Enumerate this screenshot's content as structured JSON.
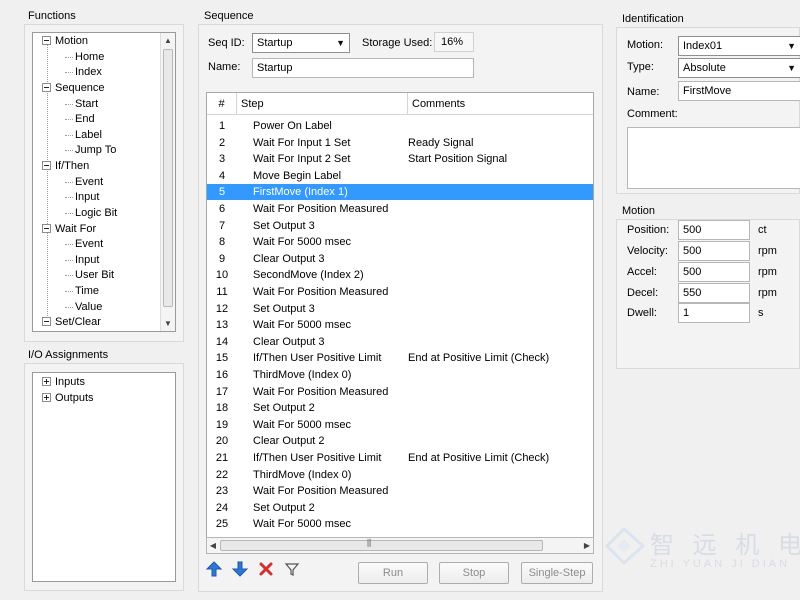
{
  "functions": {
    "title": "Functions",
    "items": [
      {
        "label": "Motion",
        "level": 0,
        "expand": "minus"
      },
      {
        "label": "Home",
        "level": 1
      },
      {
        "label": "Index",
        "level": 1
      },
      {
        "label": "Sequence",
        "level": 0,
        "expand": "minus"
      },
      {
        "label": "Start",
        "level": 1
      },
      {
        "label": "End",
        "level": 1
      },
      {
        "label": "Label",
        "level": 1
      },
      {
        "label": "Jump To",
        "level": 1
      },
      {
        "label": "If/Then",
        "level": 0,
        "expand": "minus"
      },
      {
        "label": "Event",
        "level": 1
      },
      {
        "label": "Input",
        "level": 1
      },
      {
        "label": "Logic Bit",
        "level": 1
      },
      {
        "label": "Wait For",
        "level": 0,
        "expand": "minus"
      },
      {
        "label": "Event",
        "level": 1
      },
      {
        "label": "Input",
        "level": 1
      },
      {
        "label": "User Bit",
        "level": 1
      },
      {
        "label": "Time",
        "level": 1
      },
      {
        "label": "Value",
        "level": 1
      },
      {
        "label": "Set/Clear",
        "level": 0,
        "expand": "minus"
      }
    ]
  },
  "io_assignments": {
    "title": "I/O Assignments",
    "items": [
      "Inputs",
      "Outputs"
    ]
  },
  "sequence": {
    "title": "Sequence",
    "seq_id_label": "Seq ID:",
    "seq_id_value": "Startup",
    "storage_label": "Storage Used:",
    "storage_value": "16%",
    "name_label": "Name:",
    "name_value": "Startup",
    "columns": [
      "#",
      "Step",
      "Comments"
    ],
    "rows": [
      {
        "num": "1",
        "step": "Power On Label",
        "comment": ""
      },
      {
        "num": "2",
        "step": "Wait For Input 1 Set",
        "comment": "Ready Signal"
      },
      {
        "num": "3",
        "step": "Wait For Input 2 Set",
        "comment": "Start Position Signal"
      },
      {
        "num": "4",
        "step": "Move Begin Label",
        "comment": ""
      },
      {
        "num": "5",
        "step": "FirstMove (Index 1)",
        "comment": ""
      },
      {
        "num": "6",
        "step": "Wait For Position Measured",
        "comment": ""
      },
      {
        "num": "7",
        "step": "Set Output 3",
        "comment": ""
      },
      {
        "num": "8",
        "step": "Wait For 5000 msec",
        "comment": ""
      },
      {
        "num": "9",
        "step": "Clear Output 3",
        "comment": ""
      },
      {
        "num": "10",
        "step": "SecondMove (Index 2)",
        "comment": ""
      },
      {
        "num": "11",
        "step": "Wait For Position Measured",
        "comment": ""
      },
      {
        "num": "12",
        "step": "Set Output 3",
        "comment": ""
      },
      {
        "num": "13",
        "step": "Wait For 5000 msec",
        "comment": ""
      },
      {
        "num": "14",
        "step": "Clear Output 3",
        "comment": ""
      },
      {
        "num": "15",
        "step": "If/Then User Positive Limit",
        "comment": "End at Positive Limit (Check)"
      },
      {
        "num": "16",
        "step": "ThirdMove (Index 0)",
        "comment": ""
      },
      {
        "num": "17",
        "step": "Wait For Position Measured",
        "comment": ""
      },
      {
        "num": "18",
        "step": "Set Output 2",
        "comment": ""
      },
      {
        "num": "19",
        "step": "Wait For 5000 msec",
        "comment": ""
      },
      {
        "num": "20",
        "step": "Clear Output 2",
        "comment": ""
      },
      {
        "num": "21",
        "step": "If/Then User Positive Limit",
        "comment": "End at Positive Limit (Check)"
      },
      {
        "num": "22",
        "step": "ThirdMove (Index 0)",
        "comment": ""
      },
      {
        "num": "23",
        "step": "Wait For Position Measured",
        "comment": ""
      },
      {
        "num": "24",
        "step": "Set Output 2",
        "comment": ""
      },
      {
        "num": "25",
        "step": "Wait For 5000 msec",
        "comment": ""
      }
    ],
    "selected_row": 5,
    "buttons": {
      "run": "Run",
      "stop": "Stop",
      "single_step": "Single-Step"
    },
    "toolbar_icons": [
      "up-arrow-icon",
      "down-arrow-icon",
      "delete-icon",
      "filter-icon"
    ]
  },
  "identification": {
    "title": "Identification",
    "motion_label": "Motion:",
    "motion_value": "Index01",
    "type_label": "Type:",
    "type_value": "Absolute",
    "name_label": "Name:",
    "name_value": "FirstMove",
    "comment_label": "Comment:"
  },
  "motion": {
    "title": "Motion",
    "fields": [
      {
        "label": "Position:",
        "value": "500",
        "unit": "ct"
      },
      {
        "label": "Velocity:",
        "value": "500",
        "unit": "rpm"
      },
      {
        "label": "Accel:",
        "value": "500",
        "unit": "rpm"
      },
      {
        "label": "Decel:",
        "value": "550",
        "unit": "rpm"
      },
      {
        "label": "Dwell:",
        "value": "1",
        "unit": "s"
      }
    ]
  },
  "watermark": {
    "title": "智 远 机 电",
    "subtitle": "ZHI YUAN JI DIAN"
  },
  "colors": {
    "selection": "#3399ff",
    "up_arrow": "#2f77d6",
    "down_arrow": "#2f77d6",
    "delete_icon": "#d92c2c"
  }
}
